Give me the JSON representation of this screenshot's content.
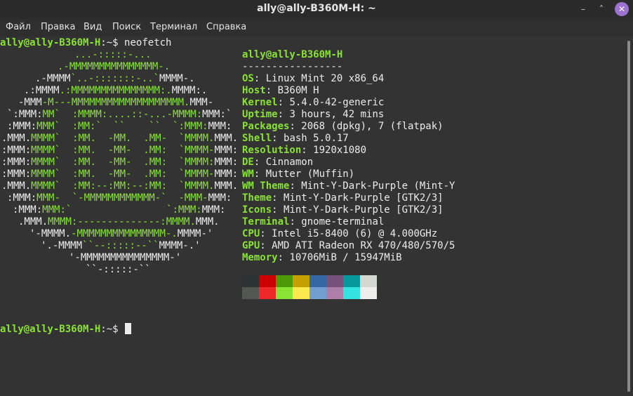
{
  "window": {
    "title": "ally@ally-B360M-H: ~",
    "controls": {
      "minimize": "–",
      "maximize": "˄",
      "close": "✕"
    }
  },
  "menu": [
    "Файл",
    "Правка",
    "Вид",
    "Поиск",
    "Терминал",
    "Справка"
  ],
  "prompt": {
    "user_host": "ally@ally-B360M-H",
    "sep": ":",
    "dir": "~",
    "symbol": "$"
  },
  "command": "neofetch",
  "logo": [
    [
      [
        "g",
        "...-:::::-..."
      ]
    ],
    [
      [
        "g",
        ".-MMMMMMMMMMMMMMM-."
      ]
    ],
    [
      [
        "w",
        ".-MMMM"
      ],
      [
        "g",
        "`..-:::::::-..`"
      ],
      [
        "w",
        "MMMM-."
      ]
    ],
    [
      [
        "w",
        ".:MMMM"
      ],
      [
        "g",
        ".:MMMMMMMMMMMMMMM:."
      ],
      [
        "w",
        "MMMM:."
      ]
    ],
    [
      [
        "w",
        "-MMM"
      ],
      [
        "g",
        "-M---MMMMMMMMMMMMMMMMMMM."
      ],
      [
        "w",
        "MMM-"
      ]
    ],
    [
      [
        "w",
        "`:MMM:"
      ],
      [
        "g",
        "MM`  :MMMM:....::-...-MMMM:"
      ],
      [
        "w",
        "MMM:`"
      ]
    ],
    [
      [
        "w",
        ":MMM:"
      ],
      [
        "g",
        "MMM`  :MM:`  ``    ``  `:MMM:"
      ],
      [
        "w",
        "MMM:"
      ]
    ],
    [
      [
        "w",
        ".MMM."
      ],
      [
        "g",
        "MMMM`  :MM.  -MM.  .MM-  `MMMM."
      ],
      [
        "w",
        "MMM."
      ]
    ],
    [
      [
        "w",
        ":MMM:"
      ],
      [
        "g",
        "MMMM`  :MM.  -MM-  .MM:  `MMMM-"
      ],
      [
        "w",
        "MMM:"
      ]
    ],
    [
      [
        "w",
        ":MMM:"
      ],
      [
        "g",
        "MMMM`  :MM.  -MM-  .MM:  `MMMM:"
      ],
      [
        "w",
        "MMM:"
      ]
    ],
    [
      [
        "w",
        ":MMM:"
      ],
      [
        "g",
        "MMMM`  :MM.  -MM-  .MM:  `MMMM-"
      ],
      [
        "w",
        "MMM:"
      ]
    ],
    [
      [
        "w",
        ".MMM."
      ],
      [
        "g",
        "MMMM`  :MM:--:MM:--:MM:  `MMMM."
      ],
      [
        "w",
        "MMM."
      ]
    ],
    [
      [
        "w",
        ":MMM:"
      ],
      [
        "g",
        "MMM-  `-MMMMMMMMMMMM-`  -MMM-"
      ],
      [
        "w",
        "MMM:"
      ]
    ],
    [
      [
        "w",
        ":MMM:"
      ],
      [
        "g",
        "MMM:`                `:MMM:"
      ],
      [
        "w",
        "MMM:"
      ]
    ],
    [
      [
        "w",
        ".MMM."
      ],
      [
        "g",
        "MMMM:--------------:MMMM."
      ],
      [
        "w",
        "MMM."
      ]
    ],
    [
      [
        "w",
        "'-MMMM."
      ],
      [
        "g",
        "-MMMMMMMMMMMMMMM-."
      ],
      [
        "w",
        "MMMM-'"
      ]
    ],
    [
      [
        "w",
        "'.-MMMM"
      ],
      [
        "g",
        "``--:::::--``"
      ],
      [
        "w",
        "MMMM-.'"
      ]
    ],
    [
      [
        "w",
        "'-MMMMMMMMMMMMMMM-'"
      ]
    ],
    [
      [
        "w",
        "``-:::::-``"
      ]
    ]
  ],
  "info": {
    "header": "ally@ally-B360M-H",
    "underline": "-----------------",
    "fields": [
      {
        "key": "OS",
        "value": "Linux Mint 20 x86_64"
      },
      {
        "key": "Host",
        "value": "B360M H"
      },
      {
        "key": "Kernel",
        "value": "5.4.0-42-generic"
      },
      {
        "key": "Uptime",
        "value": "3 hours, 42 mins"
      },
      {
        "key": "Packages",
        "value": "2068 (dpkg), 7 (flatpak)"
      },
      {
        "key": "Shell",
        "value": "bash 5.0.17"
      },
      {
        "key": "Resolution",
        "value": "1920x1080"
      },
      {
        "key": "DE",
        "value": "Cinnamon"
      },
      {
        "key": "WM",
        "value": "Mutter (Muffin)"
      },
      {
        "key": "WM Theme",
        "value": "Mint-Y-Dark-Purple (Mint-Y"
      },
      {
        "key": "Theme",
        "value": "Mint-Y-Dark-Purple [GTK2/3]"
      },
      {
        "key": "Icons",
        "value": "Mint-Y-Dark-Purple [GTK2/3]"
      },
      {
        "key": "Terminal",
        "value": "gnome-terminal"
      },
      {
        "key": "CPU",
        "value": "Intel i5-8400 (6) @ 4.000GHz"
      },
      {
        "key": "GPU",
        "value": "AMD ATI Radeon RX 470/480/570/5"
      },
      {
        "key": "Memory",
        "value": "10706MiB / 15947MiB"
      }
    ]
  },
  "palette": {
    "normal": [
      "#2e3436",
      "#cc0000",
      "#4e9a06",
      "#c4a000",
      "#3465a4",
      "#75507b",
      "#06989a",
      "#d3d7cf"
    ],
    "bright": [
      "#555753",
      "#ef2929",
      "#8ae234",
      "#fce94f",
      "#729fcf",
      "#ad7fa8",
      "#34e2e2",
      "#eeeeec"
    ]
  },
  "colors": {
    "accent_green": "#8ae234",
    "text": "#e6e6e6",
    "background": "#333333",
    "close_button": "#9b72cf"
  }
}
